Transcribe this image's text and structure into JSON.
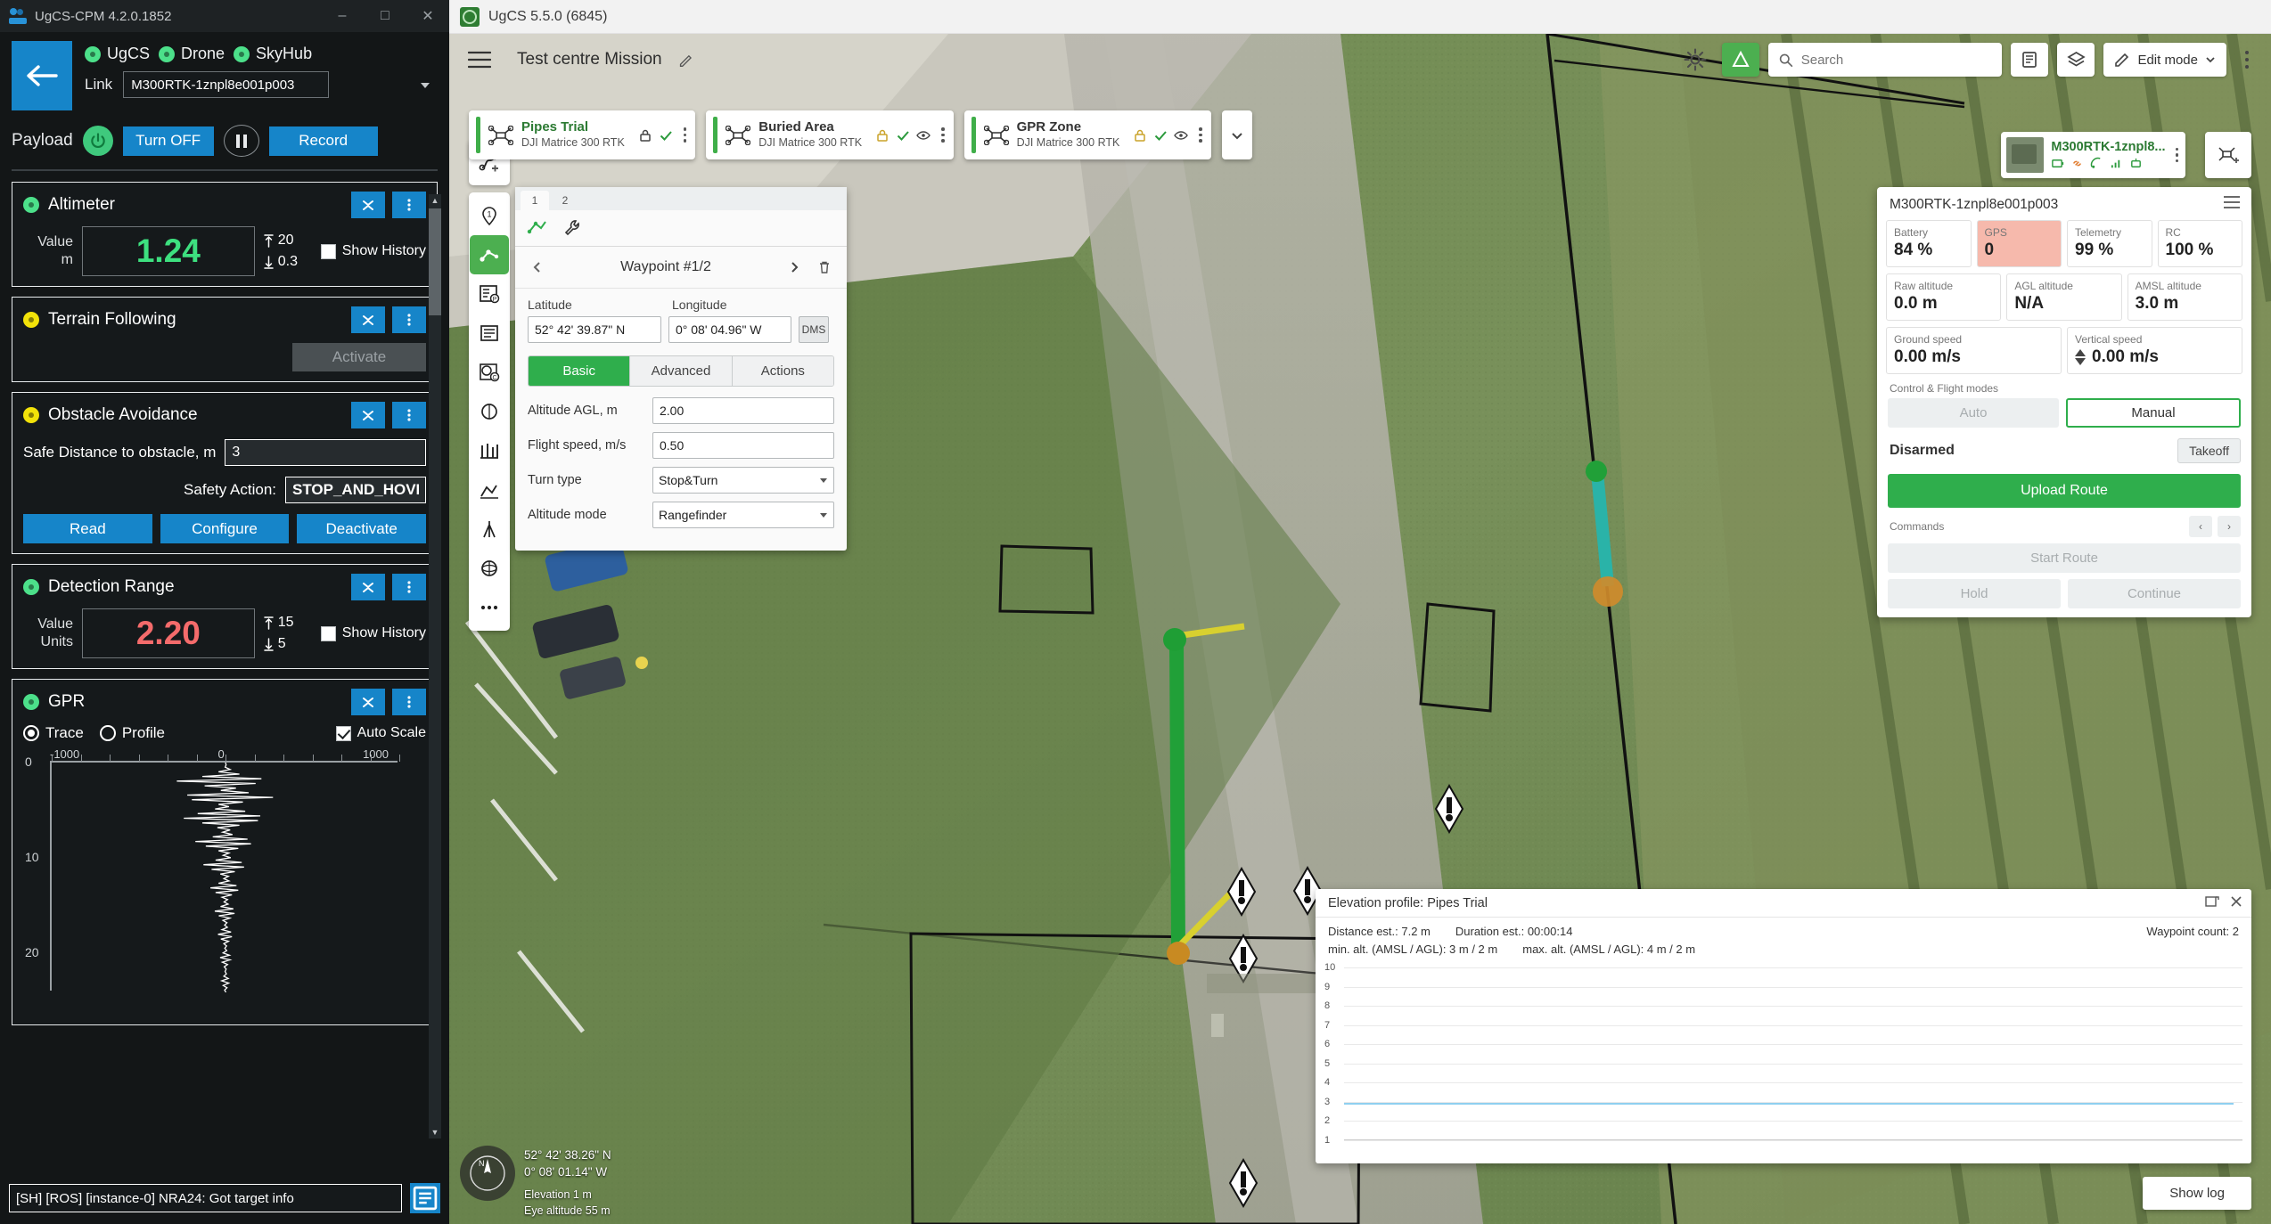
{
  "cpm": {
    "window_title": "UgCS-CPM 4.2.0.1852",
    "win_min": "–",
    "win_max": "□",
    "win_close": "✕",
    "statuses": [
      {
        "label": "UgCS",
        "state": "green"
      },
      {
        "label": "Drone",
        "state": "green"
      },
      {
        "label": "SkyHub",
        "state": "green"
      }
    ],
    "link_label": "Link",
    "link_value": "M300RTK-1znpl8e001p003",
    "payload_label": "Payload",
    "turn_off_label": "Turn OFF",
    "record_label": "Record",
    "altimeter": {
      "title": "Altimeter",
      "state": "green",
      "value_label": "Value",
      "unit_label": "m",
      "value": "1.24",
      "max": "20",
      "min": "0.3",
      "show_history_label": "Show History",
      "show_history_checked": false
    },
    "terrain": {
      "title": "Terrain Following",
      "state": "yellow",
      "activate_label": "Activate"
    },
    "obstacle": {
      "title": "Obstacle Avoidance",
      "state": "yellow",
      "safe_distance_label": "Safe Distance to obstacle, m",
      "safe_distance_value": "3",
      "safety_action_label": "Safety Action:",
      "safety_action_value": "STOP_AND_HOVER",
      "read_label": "Read",
      "configure_label": "Configure",
      "deactivate_label": "Deactivate"
    },
    "detection": {
      "title": "Detection Range",
      "state": "green",
      "value_label": "Value",
      "units_label": "Units",
      "value": "2.20",
      "max": "15",
      "min": "5",
      "show_history_label": "Show History",
      "show_history_checked": false
    },
    "gpr": {
      "title": "GPR",
      "state": "green",
      "trace_label": "Trace",
      "profile_label": "Profile",
      "mode": "Trace",
      "auto_scale_label": "Auto Scale",
      "auto_scale_checked": true
    },
    "status_message": "[SH] [ROS] [instance-0] NRA24: Got target info"
  },
  "chart_data": {
    "type": "line",
    "title": "GPR Trace",
    "xlabel": "",
    "ylabel": "",
    "x_ticks": [
      "-1000",
      "0",
      "1000"
    ],
    "y_ticks": [
      "0",
      "10",
      "20"
    ],
    "xlim": [
      -1500,
      1500
    ],
    "ylim": [
      0,
      24
    ],
    "grid": false,
    "orientation": "vertical-depth",
    "series": [
      {
        "name": "amplitude",
        "samples": [
          0,
          5,
          -3,
          40,
          -60,
          120,
          -200,
          310,
          -420,
          260,
          -180,
          90,
          -40,
          200,
          -330,
          410,
          -290,
          150,
          -60,
          30,
          -90,
          170,
          -240,
          300,
          -360,
          280,
          -200,
          120,
          -70,
          40,
          -25,
          60,
          -110,
          190,
          -260,
          220,
          -170,
          110,
          -60,
          30,
          -20,
          45,
          -85,
          140,
          -190,
          160,
          -120,
          80,
          -45,
          25,
          -15,
          30,
          -60,
          95,
          -130,
          110,
          -85,
          55,
          -30,
          18,
          -12,
          22,
          -42,
          68,
          -92,
          78,
          -58,
          38,
          -22,
          12,
          -8,
          16,
          -30,
          48,
          -65,
          55,
          -40,
          26,
          -15,
          9,
          -6,
          11,
          -21,
          34,
          -46,
          39,
          -28,
          18,
          -11,
          6,
          -4,
          8,
          -15,
          24,
          -33,
          28,
          -20,
          13,
          -8,
          4
        ]
      }
    ],
    "elevation_profile": {
      "type": "line",
      "title": "Elevation profile: Pipes Trial",
      "y_ticks": [
        "10",
        "9",
        "8",
        "7",
        "6",
        "5",
        "4",
        "3",
        "2",
        "1"
      ],
      "ylim": [
        1,
        10
      ],
      "values": [
        3,
        3,
        3,
        3,
        3
      ],
      "line_color": "#8fd0f0"
    }
  },
  "ugcs": {
    "window_title": "UgCS 5.5.0 (6845)",
    "mission_name": "Test centre Mission",
    "search_placeholder": "Search",
    "edit_mode_label": "Edit mode",
    "routes": [
      {
        "name": "Pipes Trial",
        "sub": "DJI Matrice 300 RTK",
        "accent": "#3fae49",
        "selected": true
      },
      {
        "name": "Buried Area",
        "sub": "DJI Matrice 300 RTK",
        "accent": "#3fae49",
        "selected": false
      },
      {
        "name": "GPR Zone",
        "sub": "DJI Matrice 300 RTK",
        "accent": "#3fae49",
        "selected": false
      }
    ],
    "waypoint": {
      "tab_numbers": [
        "1",
        "2"
      ],
      "title": "Waypoint #1/2",
      "latitude_label": "Latitude",
      "longitude_label": "Longitude",
      "latitude_value": "52° 42' 39.87\" N",
      "longitude_value": "0° 08' 04.96\" W",
      "dms_label": "DMS",
      "tabs": [
        "Basic",
        "Advanced",
        "Actions"
      ],
      "active_tab": "Basic",
      "fields": [
        {
          "label": "Altitude AGL, m",
          "value": "2.00",
          "type": "text"
        },
        {
          "label": "Flight speed, m/s",
          "value": "0.50",
          "type": "text"
        },
        {
          "label": "Turn type",
          "value": "Stop&Turn",
          "type": "select"
        },
        {
          "label": "Altitude mode",
          "value": "Rangefinder",
          "type": "select"
        }
      ]
    },
    "vehicle": {
      "name": "M300RTK-1znpl8...",
      "panel_title": "M300RTK-1znpl8e001p003",
      "stats_top": [
        {
          "key": "Battery",
          "value": "84 %",
          "warn": false
        },
        {
          "key": "GPS",
          "value": "0",
          "warn": true
        },
        {
          "key": "Telemetry",
          "value": "99 %",
          "warn": false
        },
        {
          "key": "RC",
          "value": "100 %",
          "warn": false
        }
      ],
      "stats_alt": [
        {
          "key": "Raw altitude",
          "value": "0.0 m"
        },
        {
          "key": "AGL altitude",
          "value": "N/A"
        },
        {
          "key": "AMSL altitude",
          "value": "3.0 m"
        }
      ],
      "stats_speed": [
        {
          "key": "Ground speed",
          "value": "0.00 m/s",
          "arrow": "none"
        },
        {
          "key": "Vertical speed",
          "value": "0.00 m/s",
          "arrow": "updown"
        }
      ],
      "control_section_label": "Control & Flight modes",
      "mode_auto": "Auto",
      "mode_manual": "Manual",
      "armed_state": "Disarmed",
      "takeoff_label": "Takeoff",
      "upload_route_label": "Upload Route",
      "commands_label": "Commands",
      "start_route_label": "Start Route",
      "hold_label": "Hold",
      "continue_label": "Continue"
    },
    "elevation": {
      "title": "Elevation profile: Pipes Trial",
      "distance": "Distance est.: 7.2 m",
      "duration": "Duration est.: 00:00:14",
      "waypoint_count": "Waypoint count: 2",
      "min_alt": "min. alt. (AMSL / AGL): 3 m / 2 m",
      "max_alt": "max. alt. (AMSL / AGL): 4 m / 2 m"
    },
    "show_log_label": "Show log",
    "map_coords_line1": "52° 42' 38.26\" N",
    "map_coords_line2": "0° 08' 01.14\" W",
    "map_elevation": "Elevation 1 m",
    "map_eye_alt": "Eye altitude 55 m"
  }
}
